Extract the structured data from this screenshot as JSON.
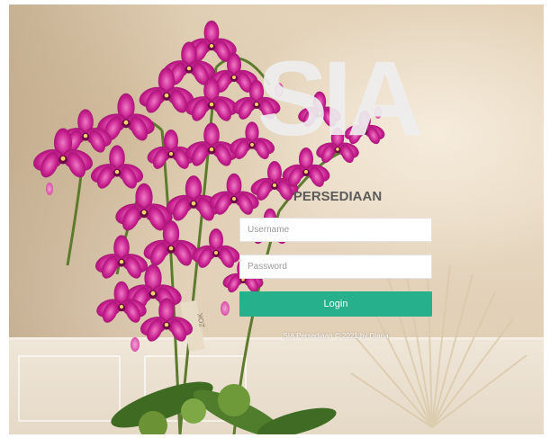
{
  "brand": {
    "title": "SIA",
    "subtitle": "PERSEDIAAN"
  },
  "login_form": {
    "username_placeholder": "Username",
    "password_placeholder": "Password",
    "login_label": "Login"
  },
  "footer": {
    "text": "SIA Persediaan © 2021 by Diana"
  },
  "background": {
    "description_icon": "orchid-photo",
    "pot_tag_text": "ZOK"
  },
  "colors": {
    "accent": "#26b08c",
    "title": "#eeeeee",
    "subtitle": "#5b5b5b",
    "orchid": "#c8208f"
  }
}
